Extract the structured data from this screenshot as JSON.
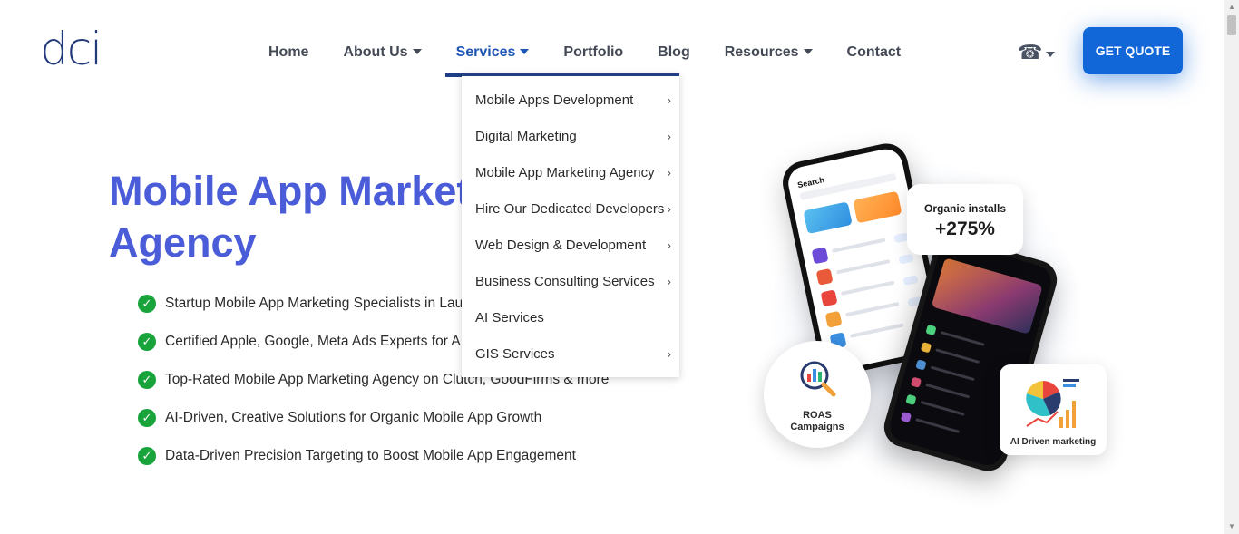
{
  "brand": {
    "logo_text": "dci",
    "accent": "#1167d8",
    "heading_color": "#4a5cd8",
    "nav_active_color": "#1f56b3"
  },
  "nav": {
    "items": [
      {
        "label": "Home",
        "has_caret": false
      },
      {
        "label": "About Us",
        "has_caret": true
      },
      {
        "label": "Services",
        "has_caret": true,
        "active": true
      },
      {
        "label": "Portfolio",
        "has_caret": false
      },
      {
        "label": "Blog",
        "has_caret": false
      },
      {
        "label": "Resources",
        "has_caret": true
      },
      {
        "label": "Contact",
        "has_caret": false
      }
    ],
    "phone_icon": "phone-icon",
    "cta_label": "GET QUOTE"
  },
  "services_menu": {
    "items": [
      {
        "label": "Mobile Apps Development",
        "has_submenu": true
      },
      {
        "label": "Digital Marketing",
        "has_submenu": true
      },
      {
        "label": "Mobile App Marketing Agency",
        "has_submenu": true
      },
      {
        "label": "Hire Our Dedicated Developers",
        "has_submenu": true
      },
      {
        "label": "Web Design & Development",
        "has_submenu": true
      },
      {
        "label": "Business Consulting Services",
        "has_submenu": true
      },
      {
        "label": "AI Services",
        "has_submenu": false
      },
      {
        "label": "GIS Services",
        "has_submenu": true
      }
    ]
  },
  "hero": {
    "title_line1": "Mobile App Market",
    "title_line2": "Agency",
    "features": [
      "Startup Mobile App Marketing Specialists in Lau",
      "Certified Apple, Google, Meta Ads Experts for A",
      "Top-Rated Mobile App Marketing Agency on Clutch, GoodFirms & more",
      "AI-Driven, Creative Solutions for Organic Mobile App Growth",
      "Data-Driven Precision Targeting to Boost Mobile App Engagement"
    ]
  },
  "illustration": {
    "organic_label": "Organic installs",
    "organic_value": "+275%",
    "roas_label_1": "ROAS",
    "roas_label_2": "Campaigns",
    "ai_label": "AI Driven marketing",
    "phone_search_label": "Search"
  }
}
